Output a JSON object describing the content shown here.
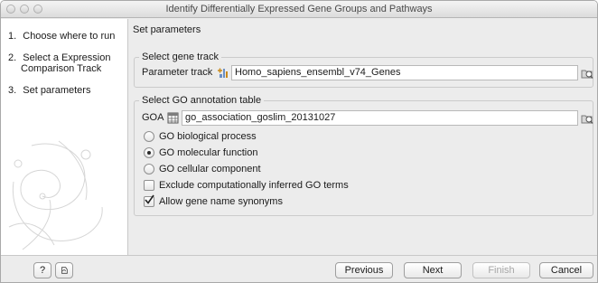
{
  "window": {
    "title": "Identify Differentially Expressed Gene Groups and Pathways"
  },
  "sidebar": {
    "steps": [
      {
        "number": "1.",
        "label": "Choose where to run"
      },
      {
        "number": "2.",
        "label_line1": "Select a Expression",
        "label_line2": "Comparison Track"
      },
      {
        "number": "3.",
        "label": "Set parameters"
      }
    ]
  },
  "panel": {
    "title": "Set parameters"
  },
  "gene_track": {
    "group_title": "Select gene track",
    "field_label": "Parameter track",
    "value": "Homo_sapiens_ensembl_v74_Genes",
    "icon": "track-icon",
    "browse_icon": "browse-folder-icon"
  },
  "go_table": {
    "group_title": "Select GO annotation table",
    "field_label": "GOA",
    "value": "go_association_goslim_20131027",
    "icon": "table-icon",
    "browse_icon": "browse-folder-icon",
    "options": [
      {
        "label": "GO biological process",
        "selected": false
      },
      {
        "label": "GO molecular function",
        "selected": true
      },
      {
        "label": "GO cellular component",
        "selected": false
      }
    ],
    "checkboxes": [
      {
        "label": "Exclude computationally inferred GO terms",
        "checked": false
      },
      {
        "label": "Allow gene name synonyms",
        "checked": true
      }
    ]
  },
  "buttons": {
    "help": "?",
    "previous": "Previous",
    "next": "Next",
    "finish": "Finish",
    "cancel": "Cancel"
  },
  "colors": {
    "window_bg": "#ececec",
    "sidebar_bg": "#ffffff",
    "border": "#cbcbcb"
  }
}
